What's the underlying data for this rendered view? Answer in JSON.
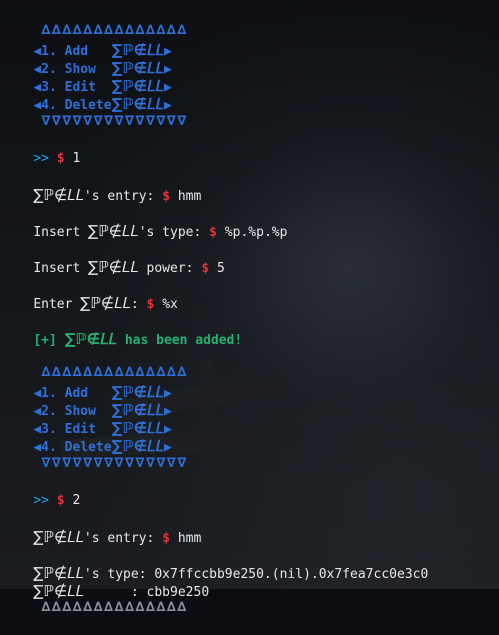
{
  "menu": {
    "top_border": "∆∆∆∆∆∆∆∆∆∆∆∆∆∆",
    "bottom_border": "∇∇∇∇∇∇∇∇∇∇∇∇∇∇",
    "left_arrow": "◀",
    "right_arrow": "▶",
    "items": [
      "1. Add   ",
      "2. Show  ",
      "3. Edit  ",
      "4. Delete"
    ],
    "spell": "∑ℙ∉𝐿𝐿"
  },
  "prompt": {
    "arrows": ">>",
    "dollar": "$"
  },
  "session": {
    "cmd1": "1",
    "entry_label": "'s entry:",
    "entry_value": "hmm",
    "insert_word": "Insert",
    "type_label": "'s type:",
    "type_value": "%p.%p.%p",
    "power_label": "power:",
    "power_value": "5",
    "enter_word": "Enter",
    "enter_label": ":",
    "enter_value": "%x",
    "added_prefix": "[+]",
    "added_text": "has been added!",
    "cmd2": "2",
    "entry2_value": "hmm",
    "show_type_label": "'s type:",
    "show_type_value": "0x7ffccbb9e250.(nil).0x7fea7cc0e3c0",
    "show_value_label": ":",
    "show_value": "cbb9e250"
  }
}
